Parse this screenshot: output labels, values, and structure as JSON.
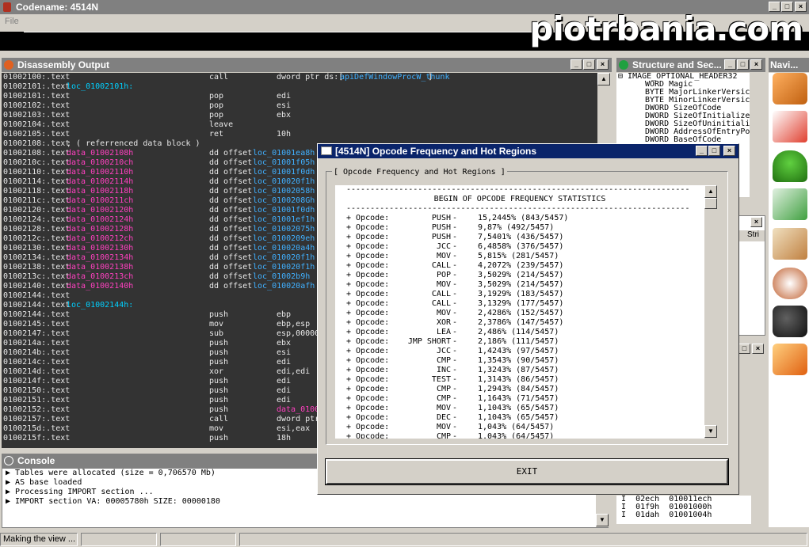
{
  "window": {
    "title": "Codename: 4514N"
  },
  "menu": {
    "file": "File"
  },
  "brand": "piotrbania.com",
  "disassembly": {
    "title": "Disassembly Output",
    "rows": [
      {
        "addr": "01002100:.text",
        "label": "",
        "op": "call",
        "arg": "dword ptr ds:[",
        "argref": "apiDefWindowProcW_thunk",
        " argtail": " ]"
      },
      {
        "addr": "01002101:.text",
        "label": "loc_01002101h:",
        "op": "",
        "arg": ""
      },
      {
        "addr": "01002101:.text",
        "label": "",
        "op": "pop",
        "arg": "edi"
      },
      {
        "addr": "01002102:.text",
        "label": "",
        "op": "pop",
        "arg": "esi"
      },
      {
        "addr": "01002103:.text",
        "label": "",
        "op": "pop",
        "arg": "ebx"
      },
      {
        "addr": "01002104:.text",
        "label": "",
        "op": "leave",
        "arg": ""
      },
      {
        "addr": "01002105:.text",
        "label": "",
        "op": "ret",
        "arg": "10h"
      },
      {
        "addr": "01002108:.text",
        "label": "; ( referrenced data block )",
        "op": "",
        "arg": ""
      },
      {
        "addr": "01002108:.text",
        "label": "data_01002108h",
        "op": " dd offset",
        "arg": "loc_01001ea8h"
      },
      {
        "addr": "0100210c:.text",
        "label": "data_0100210ch",
        "op": " dd offset",
        "arg": "loc_01001f05h"
      },
      {
        "addr": "01002110:.text",
        "label": "data_01002110h",
        "op": " dd offset",
        "arg": "loc_01001f0dh"
      },
      {
        "addr": "01002114:.text",
        "label": "data_01002114h",
        "op": " dd offset",
        "arg": "loc_010020f1h"
      },
      {
        "addr": "01002118:.text",
        "label": "data_01002118h",
        "op": " dd offset",
        "arg": "loc_01002058h"
      },
      {
        "addr": "0100211c:.text",
        "label": "data_0100211ch",
        "op": " dd offset",
        "arg": "loc_0100208Gh"
      },
      {
        "addr": "01002120:.text",
        "label": "data_01002120h",
        "op": " dd offset",
        "arg": "loc_01001f0dh"
      },
      {
        "addr": "01002124:.text",
        "label": "data_01002124h",
        "op": " dd offset",
        "arg": "loc_01001ef1h"
      },
      {
        "addr": "01002128:.text",
        "label": "data_01002128h",
        "op": " dd offset",
        "arg": "loc_01002075h"
      },
      {
        "addr": "0100212c:.text",
        "label": "data_0100212ch",
        "op": " dd offset",
        "arg": "loc_0100209eh"
      },
      {
        "addr": "01002130:.text",
        "label": "data_01002130h",
        "op": " dd offset",
        "arg": "loc_010020a4h"
      },
      {
        "addr": "01002134:.text",
        "label": "data_01002134h",
        "op": " dd offset",
        "arg": "loc_010020f1h"
      },
      {
        "addr": "01002138:.text",
        "label": "data_01002138h",
        "op": " dd offset",
        "arg": "loc_010020f1h"
      },
      {
        "addr": "0100213c:.text",
        "label": "data_0100213ch",
        "op": " dd offset",
        "arg": "loc_01002b9h"
      },
      {
        "addr": "01002140:.text",
        "label": "data_01002140h",
        "op": " dd offset",
        "arg": "loc_010020afh"
      },
      {
        "addr": "01002144:.text",
        "label": "",
        "op": "",
        "arg": ""
      },
      {
        "addr": "01002144:.text",
        "label": "loc_01002144h:",
        "op": "",
        "arg": ""
      },
      {
        "addr": "01002144:.text",
        "label": "",
        "op": "push",
        "arg": "ebp"
      },
      {
        "addr": "01002145:.text",
        "label": "",
        "op": "mov",
        "arg": "ebp,esp"
      },
      {
        "addr": "01002147:.text",
        "label": "",
        "op": "sub",
        "arg": "esp,000000"
      },
      {
        "addr": "0100214a:.text",
        "label": "",
        "op": "push",
        "arg": "ebx"
      },
      {
        "addr": "0100214b:.text",
        "label": "",
        "op": "push",
        "arg": "esi"
      },
      {
        "addr": "0100214c:.text",
        "label": "",
        "op": "push",
        "arg": "edi"
      },
      {
        "addr": "0100214d:.text",
        "label": "",
        "op": "xor",
        "arg": "edi,edi"
      },
      {
        "addr": "0100214f:.text",
        "label": "",
        "op": "push",
        "arg": "edi"
      },
      {
        "addr": "01002150:.text",
        "label": "",
        "op": "push",
        "arg": "edi"
      },
      {
        "addr": "01002151:.text",
        "label": "",
        "op": "push",
        "arg": "edi"
      },
      {
        "addr": "01002152:.text",
        "label": "",
        "op": "push",
        "arg": "data_0100"
      },
      {
        "addr": "01002157:.text",
        "label": "",
        "op": "call",
        "arg": "dword ptr"
      },
      {
        "addr": "0100215d:.text",
        "label": "",
        "op": "mov",
        "arg": "esi,eax"
      },
      {
        "addr": "0100215f:.text",
        "label": "",
        "op": "push",
        "arg": "18h"
      }
    ]
  },
  "console": {
    "title": "Console",
    "lines": [
      "Tables were allocated (size = 0,706570 Mb)",
      "AS base loaded",
      "Processing IMPORT section ...",
      "IMPORT section VA: 00005780h SIZE: 00000180"
    ]
  },
  "status": {
    "text": "Making the view ..."
  },
  "structure": {
    "title": "Structure and Sec...",
    "rows": [
      "IMAGE_OPTIONAL_HEADER32",
      "WORD   Magic",
      "BYTE   MajorLinkerVersic",
      "BYTE   MinorLinkerVersic",
      "DWORD  SizeOfCode",
      "DWORD  SizeOfInitialized",
      "DWORD  SizeOfUninitializ",
      "DWORD  AddressOfEntryPo",
      "DWORD  BaseOfCode"
    ]
  },
  "navi": {
    "title": "Navi..."
  },
  "mid_right": {
    "header": "Stri"
  },
  "bottom_right": {
    "rows": [
      {
        "c1": "02ech",
        "c2": "010011ech"
      },
      {
        "c1": "01f9h",
        "c2": "01001000h"
      },
      {
        "c1": "01dah",
        "c2": "01001004h"
      }
    ]
  },
  "dialog": {
    "title": "[4514N] Opcode Frequency and Hot Regions",
    "group_label": "[ Opcode Frequency and Hot Regions ]",
    "header": "BEGIN OF OPCODE FREQUENCY STATISTICS",
    "rule": "------------------------------------------------------------------------",
    "prefix": "+ Opcode:",
    "rows": [
      {
        "op": "PUSH",
        "pct": "15,2445% (843/5457)"
      },
      {
        "op": "PUSH",
        "pct": "9,87% (492/5457)"
      },
      {
        "op": "PUSH",
        "pct": "7,5401% (436/5457)"
      },
      {
        "op": "JCC",
        "pct": "6,4858% (376/5457)"
      },
      {
        "op": "MOV",
        "pct": "5,815% (281/5457)"
      },
      {
        "op": "CALL",
        "pct": "4,2072% (239/5457)"
      },
      {
        "op": "POP",
        "pct": "3,5029% (214/5457)"
      },
      {
        "op": "MOV",
        "pct": "3,5029% (214/5457)"
      },
      {
        "op": "CALL",
        "pct": "3,1929% (183/5457)"
      },
      {
        "op": "CALL",
        "pct": "3,1329% (177/5457)"
      },
      {
        "op": "MOV",
        "pct": "2,4286% (152/5457)"
      },
      {
        "op": "XOR",
        "pct": "2,3786% (147/5457)"
      },
      {
        "op": "LEA",
        "pct": "2,486% (114/5457)"
      },
      {
        "op": "JMP SHORT",
        "pct": "2,186% (111/5457)"
      },
      {
        "op": "JCC",
        "pct": "1,4243% (97/5457)"
      },
      {
        "op": "CMP",
        "pct": "1,3543% (90/5457)"
      },
      {
        "op": "INC",
        "pct": "1,3243% (87/5457)"
      },
      {
        "op": "TEST",
        "pct": "1,3143% (86/5457)"
      },
      {
        "op": "CMP",
        "pct": "1,2943% (84/5457)"
      },
      {
        "op": "CMP",
        "pct": "1,1643% (71/5457)"
      },
      {
        "op": "MOV",
        "pct": "1,1043% (65/5457)"
      },
      {
        "op": "DEC",
        "pct": "1,1043% (65/5457)"
      },
      {
        "op": "MOV",
        "pct": "1,043% (64/5457)"
      },
      {
        "op": "CMP",
        "pct": "1,043% (64/5457)"
      }
    ],
    "exit_label": "EXIT"
  },
  "colors": {
    "label_pink": "#ff40c0",
    "label_cyan": "#00d0ff",
    "ref_cyan": "#40b0ff",
    "dialog_title": "#0a246a"
  }
}
